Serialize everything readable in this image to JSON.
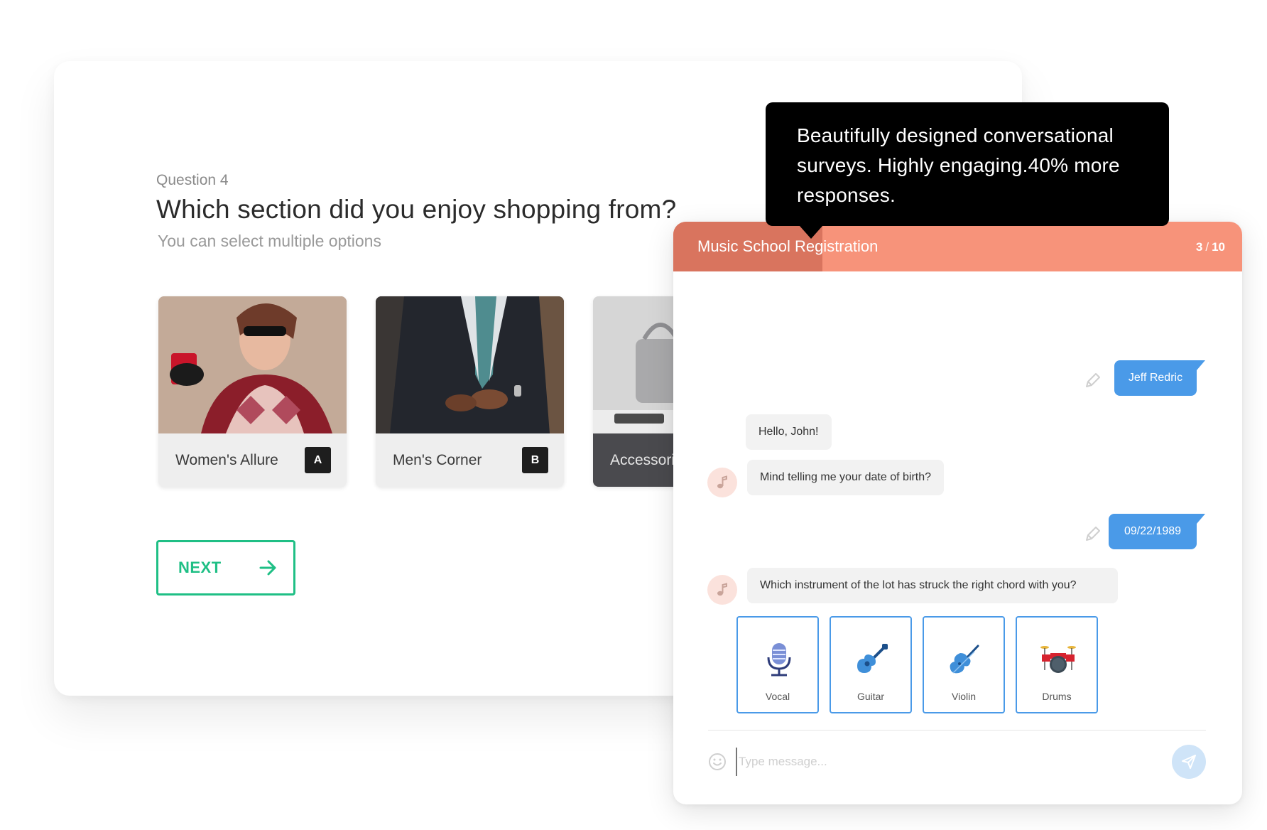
{
  "survey": {
    "question_number": "Question 4",
    "question_title": "Which section did you enjoy shopping from?",
    "question_subtitle": "You can select multiple options",
    "options": [
      {
        "label": "Women's Allure",
        "key": "A"
      },
      {
        "label": "Men's Corner",
        "key": "B"
      },
      {
        "label": "Accessori",
        "key": ""
      }
    ],
    "next_label": "NEXT",
    "accent_color": "#1fbf85"
  },
  "tooltip": {
    "text": "Beautifully designed conversational surveys. Highly engaging.40% more responses."
  },
  "chat": {
    "title": "Music School Registration",
    "progress_current": "3",
    "progress_total": "10",
    "header_color": "#f7937a",
    "messages": {
      "user_name": "Jeff Redric",
      "bot_greeting": "Hello, John!",
      "bot_dob_question": "Mind telling me your date of birth?",
      "user_dob": "09/22/1989",
      "bot_instrument_question": "Which instrument of the lot has struck the right chord with you?"
    },
    "choices": [
      {
        "label": "Vocal",
        "icon": "microphone-icon"
      },
      {
        "label": "Guitar",
        "icon": "guitar-icon"
      },
      {
        "label": "Violin",
        "icon": "violin-icon"
      },
      {
        "label": "Drums",
        "icon": "drums-icon"
      }
    ],
    "input_placeholder": "Type message...",
    "user_bubble_color": "#4a9ae8"
  }
}
